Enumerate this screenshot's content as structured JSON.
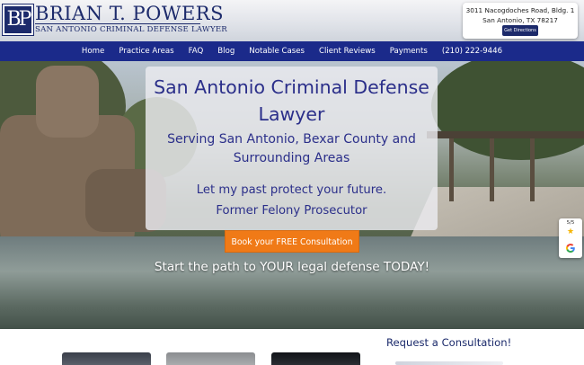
{
  "header": {
    "logo_text": "BP",
    "firm_name": "BRIAN T. POWERS",
    "firm_tagline": "SAN ANTONIO CRIMINAL DEFENSE LAWYER",
    "address_line1": "3011 Nacogdoches Road, Bldg. 1",
    "address_line2": "San Antonio, TX 78217",
    "directions_label": "Get Directions"
  },
  "nav": {
    "items": [
      "Home",
      "Practice Areas",
      "FAQ",
      "Blog",
      "Notable Cases",
      "Client Reviews",
      "Payments",
      "(210) 222-9446"
    ]
  },
  "hero": {
    "title": "San Antonio Criminal Defense Lawyer",
    "subtitle": "Serving San Antonio, Bexar County and Surrounding Areas",
    "line1": "Let my past protect your future.",
    "line2": "Former Felony Prosecutor",
    "cta_label": "Book your FREE Consultation",
    "tagline": "Start the path to YOUR legal defense TODAY!"
  },
  "review_badge": {
    "score_text": "5/5",
    "rating_fraction": 1.0,
    "icons": [
      "star-icon",
      "google-icon"
    ]
  },
  "bottom": {
    "consult_title": "Request a Consultation!"
  },
  "colors": {
    "brand_navy": "#1c2a6b",
    "nav_blue": "#1b2a8a",
    "cta_orange": "#f07a17",
    "hero_text": "#2b2f8a"
  }
}
